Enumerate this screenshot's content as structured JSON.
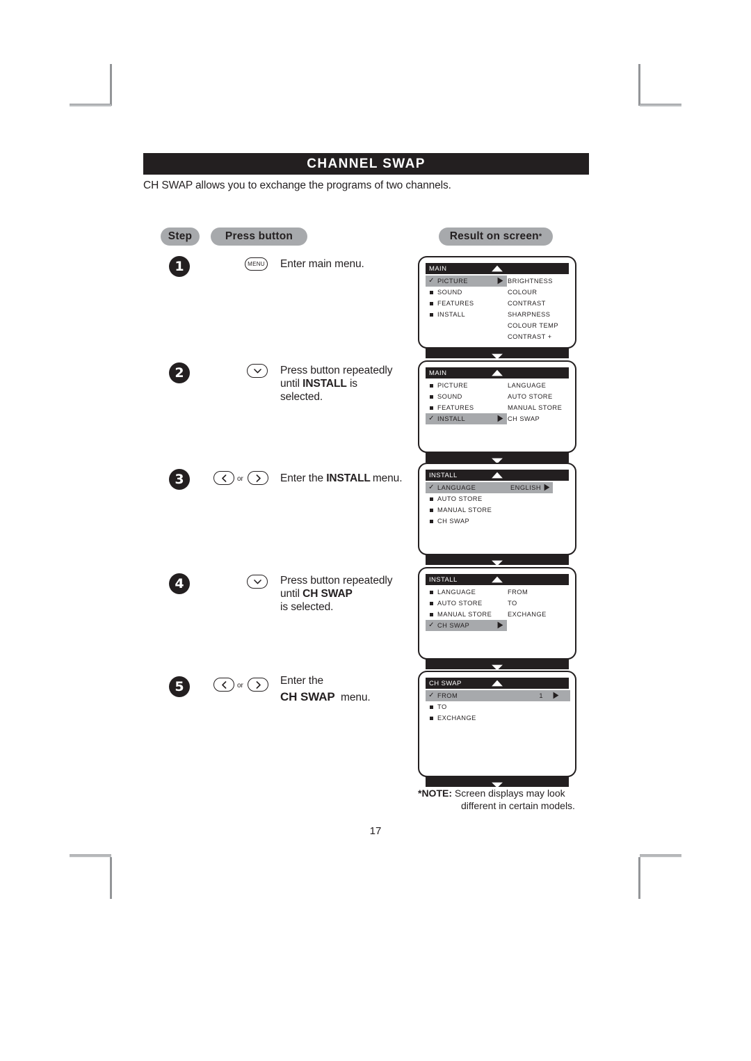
{
  "document": {
    "title": "CHANNEL  SWAP",
    "intro": "CH SWAP allows you to exchange the programs of two channels.",
    "page_number": "17"
  },
  "headers": {
    "step": "Step",
    "press_button": "Press button",
    "result_on_screen": "Result on screen",
    "result_asterisk": "*"
  },
  "note": {
    "label": "*NOTE:",
    "line1": "Screen displays may look",
    "line2": "different in certain models."
  },
  "steps": [
    {
      "number": "1",
      "button_type": "menu",
      "button_label": "MENU",
      "or_label": "",
      "text_parts": [
        {
          "text": "Enter main menu.",
          "bold": false
        }
      ]
    },
    {
      "number": "2",
      "button_type": "down",
      "button_label": "",
      "or_label": "",
      "text_parts": [
        {
          "text": "Press button repeatedly",
          "bold": false
        },
        {
          "text": "until ",
          "bold": false
        },
        {
          "text": "INSTALL",
          "bold": true
        },
        {
          "text": " is",
          "bold": false
        },
        {
          "text": "selected.",
          "bold": false
        }
      ]
    },
    {
      "number": "3",
      "button_type": "left-or-right",
      "button_label": "",
      "or_label": "or",
      "text_parts": [
        {
          "text": "Enter the ",
          "bold": false
        },
        {
          "text": "INSTALL",
          "bold": true
        },
        {
          "text": "menu.",
          "bold": false
        }
      ]
    },
    {
      "number": "4",
      "button_type": "down",
      "button_label": "",
      "or_label": "",
      "text_parts": [
        {
          "text": "Press button repeatedly",
          "bold": false
        },
        {
          "text": "until ",
          "bold": false
        },
        {
          "text": "CH SWAP",
          "bold": true
        },
        {
          "text": "is selected.",
          "bold": false
        }
      ]
    },
    {
      "number": "5",
      "button_type": "left-or-right",
      "button_label": "",
      "or_label": "or",
      "text_parts": [
        {
          "text": "Enter the",
          "bold": false
        },
        {
          "text": "CH SWAP",
          "bold": true
        },
        {
          "text": " menu.",
          "bold": false
        }
      ]
    }
  ],
  "step_text_lines": [
    [
      "Enter main menu."
    ],
    [
      "Press button repeatedly",
      "until INSTALL is",
      "selected."
    ],
    [
      "Enter the INSTALL menu."
    ],
    [
      "Press button repeatedly",
      "until CH SWAP",
      "is selected."
    ],
    [
      "Enter the",
      "CH SWAP  menu."
    ]
  ],
  "screens": [
    {
      "title": "MAIN",
      "rows": [
        {
          "label": "PICTURE",
          "selected": true,
          "value": "",
          "arrow": true
        },
        {
          "label": "SOUND",
          "selected": false,
          "value": "",
          "arrow": false
        },
        {
          "label": "FEATURES",
          "selected": false,
          "value": "",
          "arrow": false
        },
        {
          "label": "INSTALL",
          "selected": false,
          "value": "",
          "arrow": false
        }
      ],
      "column2": [
        "BRIGHTNESS",
        "COLOUR",
        "CONTRAST",
        "SHARPNESS",
        "COLOUR  TEMP",
        "CONTRAST +"
      ]
    },
    {
      "title": "MAIN",
      "rows": [
        {
          "label": "PICTURE",
          "selected": false,
          "value": "",
          "arrow": false
        },
        {
          "label": "SOUND",
          "selected": false,
          "value": "",
          "arrow": false
        },
        {
          "label": "FEATURES",
          "selected": false,
          "value": "",
          "arrow": false
        },
        {
          "label": "INSTALL",
          "selected": true,
          "value": "",
          "arrow": true
        }
      ],
      "column2": [
        "LANGUAGE",
        "AUTO  STORE",
        "MANUAL  STORE",
        "CH  SWAP"
      ]
    },
    {
      "title": "INSTALL",
      "rows": [
        {
          "label": "LANGUAGE",
          "selected": true,
          "value": "ENGLISH",
          "arrow": true
        },
        {
          "label": "AUTO  STORE",
          "selected": false,
          "value": "",
          "arrow": false
        },
        {
          "label": "MANUAL  STORE",
          "selected": false,
          "value": "",
          "arrow": false
        },
        {
          "label": "CH  SWAP",
          "selected": false,
          "value": "",
          "arrow": false
        }
      ],
      "column2": []
    },
    {
      "title": "INSTALL",
      "rows": [
        {
          "label": "LANGUAGE",
          "selected": false,
          "value": "",
          "arrow": false
        },
        {
          "label": "AUTO  STORE",
          "selected": false,
          "value": "",
          "arrow": false
        },
        {
          "label": "MANUAL  STORE",
          "selected": false,
          "value": "",
          "arrow": false
        },
        {
          "label": "CH  SWAP",
          "selected": true,
          "value": "",
          "arrow": true
        }
      ],
      "column2": [
        "FROM",
        "TO",
        "EXCHANGE"
      ]
    },
    {
      "title": "CH SWAP",
      "rows": [
        {
          "label": "FROM",
          "selected": true,
          "value": "1",
          "arrow": true
        },
        {
          "label": "TO",
          "selected": false,
          "value": "",
          "arrow": false
        },
        {
          "label": "EXCHANGE",
          "selected": false,
          "value": "",
          "arrow": false
        }
      ],
      "column2": []
    }
  ],
  "colors": {
    "ink": "#231f20",
    "highlight": "#a7a9ac",
    "paper": "#ffffff"
  }
}
